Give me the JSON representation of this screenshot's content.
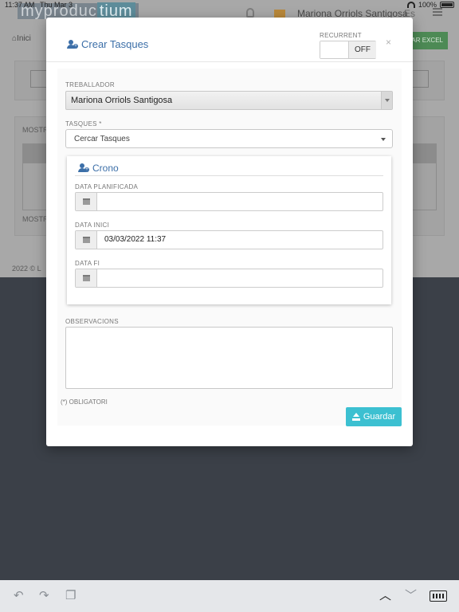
{
  "status_bar": {
    "time": "11:37 AM",
    "date": "Thu Mar 3",
    "battery": "100%"
  },
  "header": {
    "logo_left": "myproduc",
    "logo_right": "tium",
    "user": "Mariona Orriols Santigosa",
    "lang": "Es"
  },
  "background": {
    "breadcrumb": "Inici",
    "excel_button": "AR EXCEL",
    "mostrar_top": "MOSTR",
    "mostrar_bottom": "MOSTR",
    "footer": "2022 © L"
  },
  "modal": {
    "title": "Crear Tasques",
    "recurrent_label": "RECURRENT",
    "toggle_value": "OFF",
    "close": "×",
    "worker_label": "TREBALLADOR",
    "worker_value": "Mariona Orriols Santigosa",
    "tasks_label": "TASQUES *",
    "tasks_placeholder": "Cercar Tasques",
    "crono": {
      "title": "Crono",
      "data_planificada_label": "DATA PLANIFICADA",
      "data_planificada_value": "",
      "data_inici_label": "DATA INICI",
      "data_inici_value": "03/03/2022 11:37",
      "data_fi_label": "DATA FI",
      "data_fi_value": ""
    },
    "observacions_label": "OBSERVACIONS",
    "obligatori_note": "(*) OBLIGATORI",
    "save_button": "Guardar"
  },
  "accent_colors": {
    "title_blue": "#3c6fa8",
    "save_cyan": "#3cc0d1",
    "excel_green": "#4d8a55"
  }
}
